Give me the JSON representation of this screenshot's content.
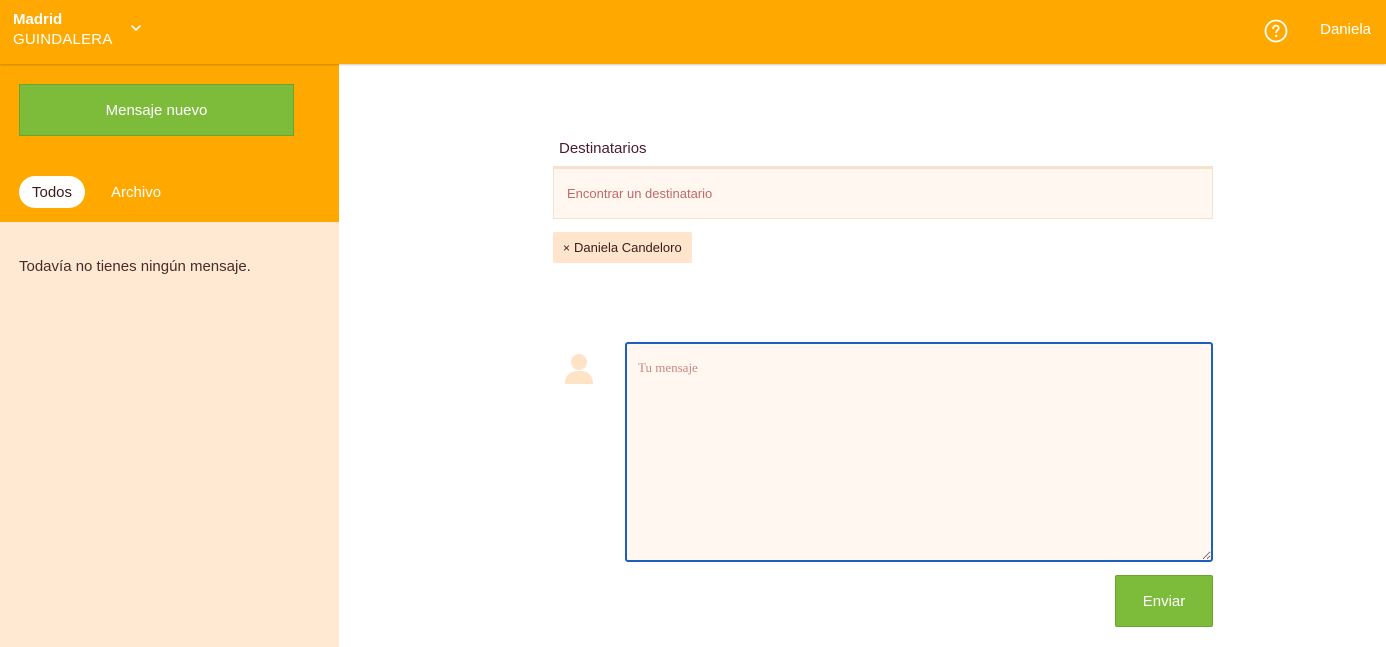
{
  "header": {
    "city": "Madrid",
    "area": "GUINDALERA",
    "chevron_icon": "chevron-down-icon",
    "help_icon": "help-circle-icon",
    "user_name": "Daniela"
  },
  "sidebar": {
    "new_message_label": "Mensaje nuevo",
    "tabs": [
      {
        "label": "Todos",
        "active": true
      },
      {
        "label": "Archivo",
        "active": false
      }
    ],
    "empty_text": "Todavía no tienes ningún mensaje."
  },
  "compose": {
    "recipients_label": "Destinatarios",
    "recipient_placeholder": "Encontrar un destinatario",
    "recipients": [
      {
        "remove_symbol": "×",
        "name": "Daniela Candeloro"
      }
    ],
    "avatar_icon": "user-avatar-icon",
    "message_placeholder": "Tu mensaje",
    "send_label": "Enviar"
  },
  "colors": {
    "brand_orange": "#ffa800",
    "sidebar_bg": "#ffe9d3",
    "button_green": "#7dbb3b",
    "focus_blue": "#1d5fbf"
  }
}
